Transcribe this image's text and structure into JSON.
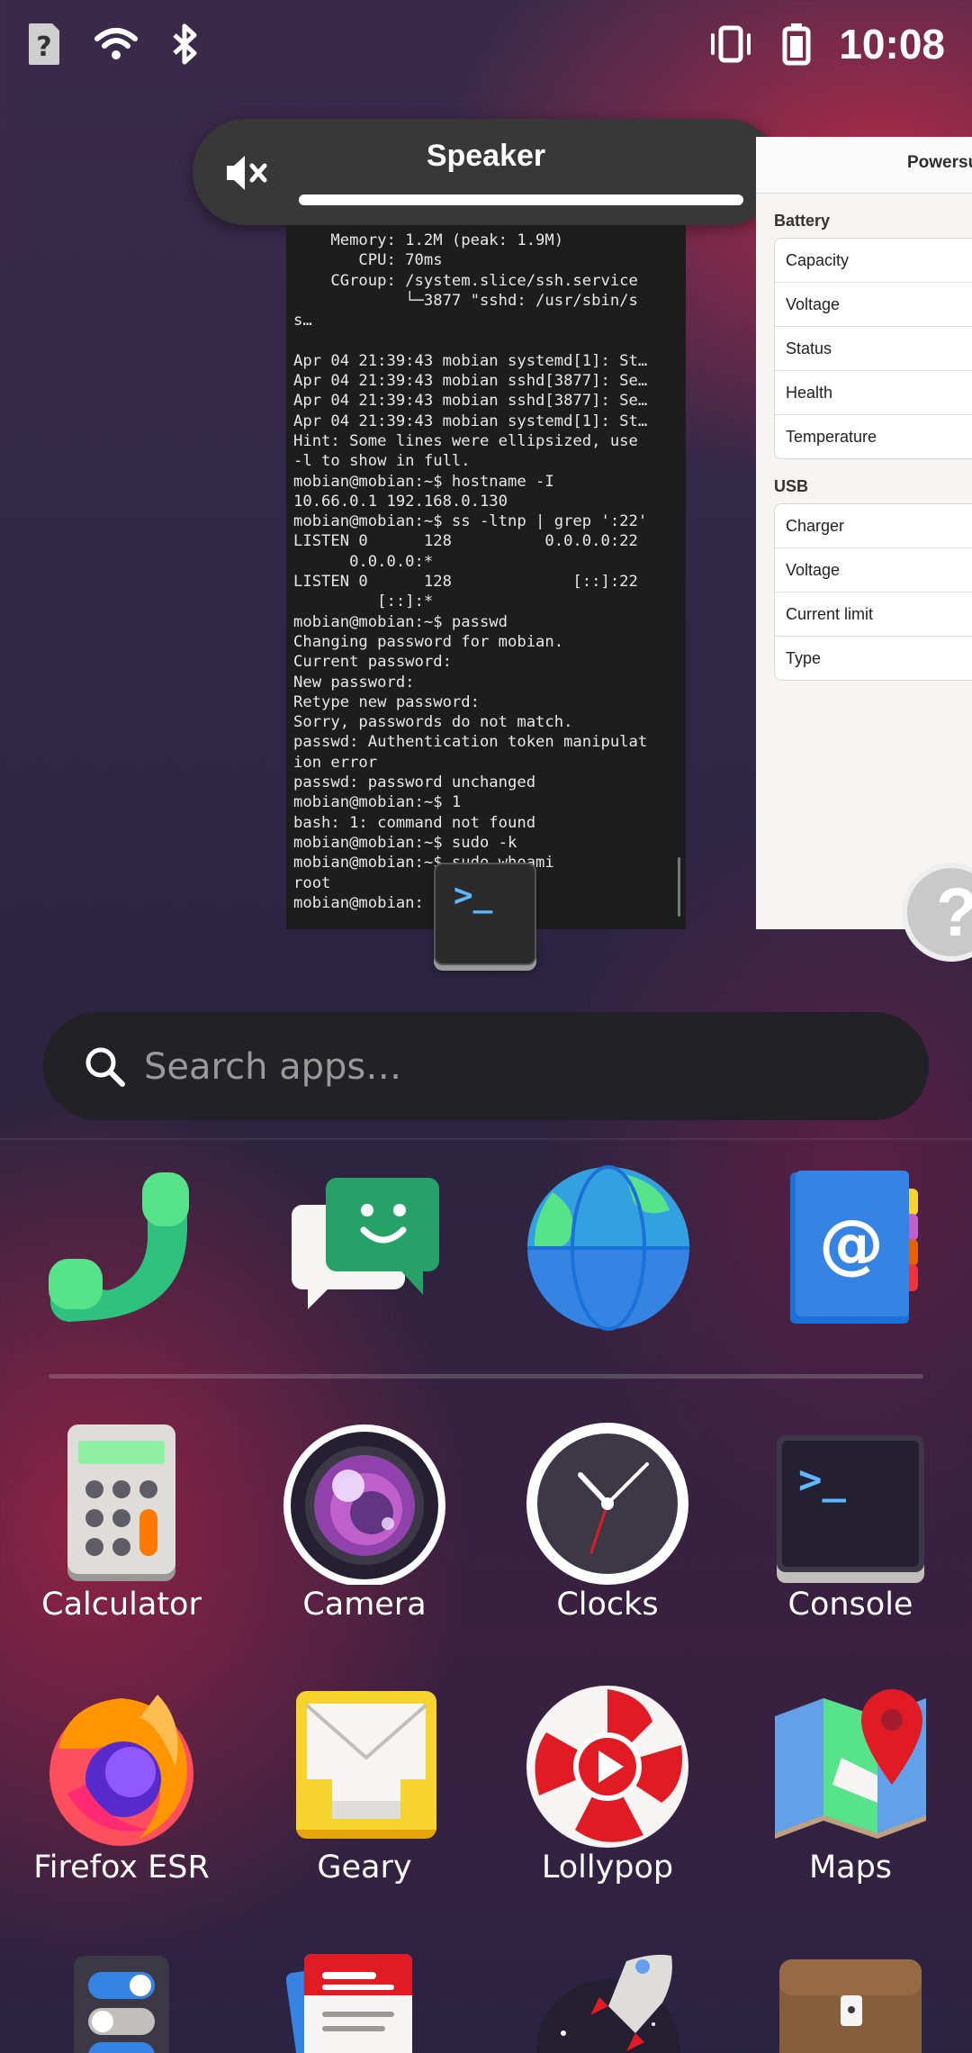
{
  "status_bar": {
    "left_icons": [
      "unknown-sim-icon",
      "wifi-icon",
      "bluetooth-icon"
    ],
    "right_icons": [
      "vibrate-icon",
      "battery-icon"
    ],
    "time": "10:08"
  },
  "osd": {
    "label": "Speaker",
    "icon": "speaker-muted-icon",
    "level": 1.0
  },
  "terminal": {
    "lines": [
      "    Memory: 1.2M (peak: 1.9M)",
      "       CPU: 70ms",
      "    CGroup: /system.slice/ssh.service",
      "            └─3877 \"sshd: /usr/sbin/s",
      "s…",
      "",
      "Apr 04 21:39:43 mobian systemd[1]: St…",
      "Apr 04 21:39:43 mobian sshd[3877]: Se…",
      "Apr 04 21:39:43 mobian sshd[3877]: Se…",
      "Apr 04 21:39:43 mobian systemd[1]: St…",
      "Hint: Some lines were ellipsized, use",
      "-l to show in full.",
      "mobian@mobian:~$ hostname -I",
      "10.66.0.1 192.168.0.130",
      "mobian@mobian:~$ ss -ltnp | grep ':22'",
      "LISTEN 0      128          0.0.0.0:22",
      "      0.0.0.0:*",
      "LISTEN 0      128             [::]:22",
      "         [::]:*",
      "mobian@mobian:~$ passwd",
      "Changing password for mobian.",
      "Current password:",
      "New password:",
      "Retype new password:",
      "Sorry, passwords do not match.",
      "passwd: Authentication token manipulat",
      "ion error",
      "passwd: password unchanged",
      "mobian@mobian:~$ 1",
      "bash: 1: command not found",
      "mobian@mobian:~$ sudo -k",
      "mobian@mobian:~$ sudo whoami",
      "root",
      "mobian@mobian:"
    ],
    "app_icon_glyph": ">_"
  },
  "power_supply": {
    "title": "Powersu",
    "sections": [
      {
        "name": "Battery",
        "rows": [
          "Capacity",
          "Voltage",
          "Status",
          "Health",
          "Temperature"
        ]
      },
      {
        "name": "USB",
        "rows": [
          "Charger",
          "Voltage",
          "Current limit",
          "Type"
        ]
      }
    ],
    "help_glyph": "?"
  },
  "search": {
    "placeholder": "Search apps…"
  },
  "dock": [
    {
      "name": "phone-icon"
    },
    {
      "name": "chat-icon"
    },
    {
      "name": "web-browser-icon"
    },
    {
      "name": "contacts-icon"
    }
  ],
  "apps": [
    {
      "label": "Calculator",
      "icon": "calculator-icon"
    },
    {
      "label": "Camera",
      "icon": "camera-icon"
    },
    {
      "label": "Clocks",
      "icon": "clock-icon"
    },
    {
      "label": "Console",
      "icon": "console-icon"
    },
    {
      "label": "Firefox ESR",
      "icon": "firefox-icon"
    },
    {
      "label": "Geary",
      "icon": "mail-icon"
    },
    {
      "label": "Lollypop",
      "icon": "music-player-icon"
    },
    {
      "label": "Maps",
      "icon": "maps-icon"
    }
  ],
  "partial_row_icons": [
    "settings-icon",
    "document-icon",
    "rocket-icon",
    "briefcase-icon"
  ]
}
